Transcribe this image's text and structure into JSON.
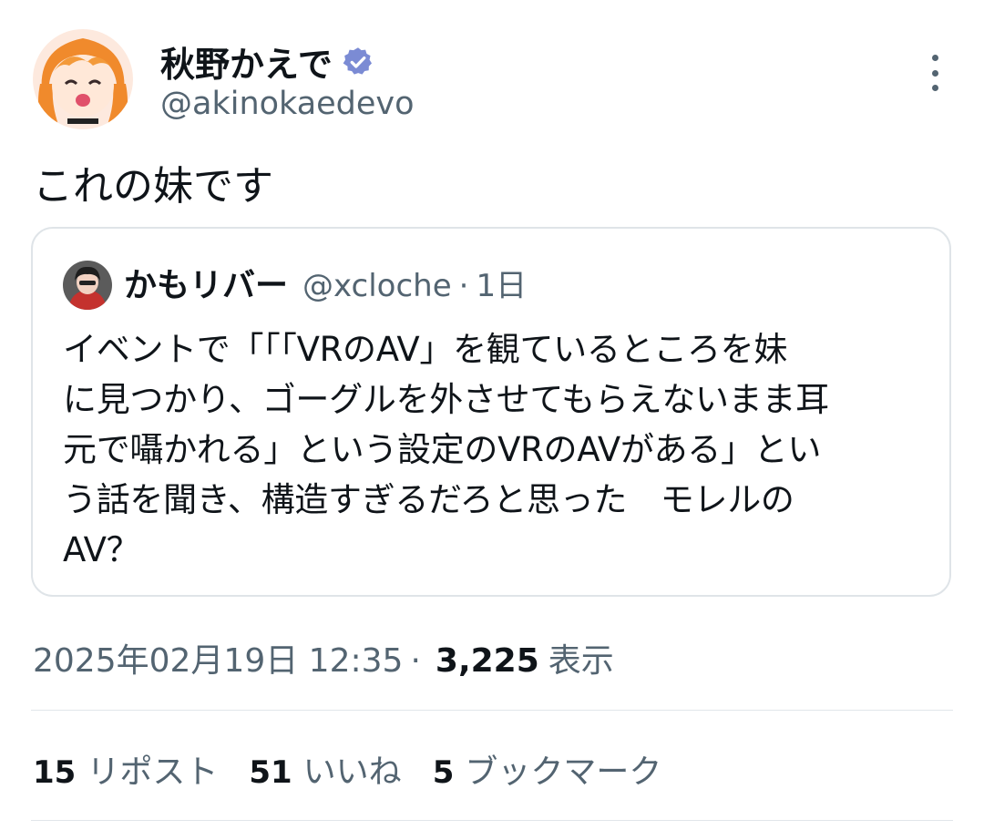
{
  "author": {
    "name": "秋野かえで",
    "handle": "@akinokaedevo",
    "verified_color": "#7b8bd4",
    "avatar_icon": "anime-girl-avatar-icon"
  },
  "tweet": {
    "text": "これの妹です"
  },
  "quoted": {
    "name": "かもリバー",
    "handle": "@xcloche",
    "dot": "·",
    "time": "1日",
    "lines": [
      "イベントで「「「VRのAV」を観ているところを妹",
      "に見つかり、ゴーグルを外させてもらえないまま耳",
      "元で囁かれる」という設定のVRのAVがある」とい",
      "う話を聞き、構造すぎるだろと思った　モレルの",
      "AV？"
    ]
  },
  "meta": {
    "timestamp": "2025年02月19日 12:35",
    "sep": "·",
    "views_count": "3,225",
    "views_label": "表示"
  },
  "stats": {
    "reposts_count": "15",
    "reposts_label": "リポスト",
    "likes_count": "51",
    "likes_label": "いいね",
    "bookmarks_count": "5",
    "bookmarks_label": "ブックマーク"
  }
}
